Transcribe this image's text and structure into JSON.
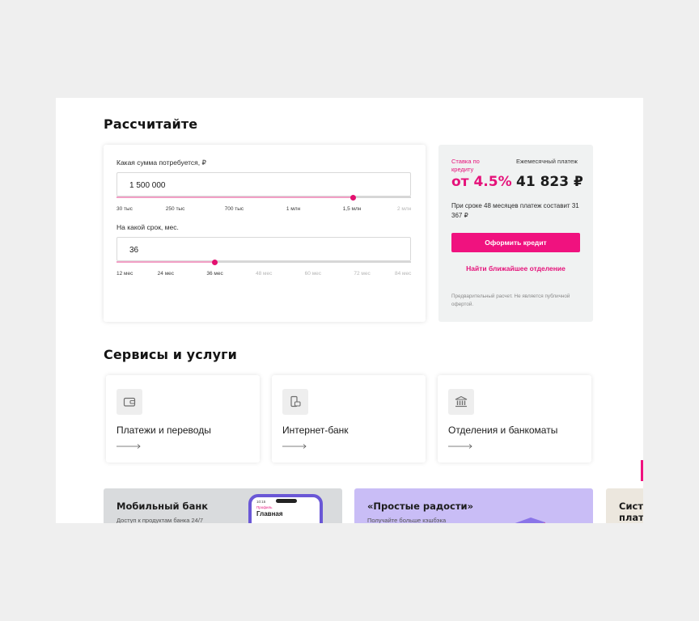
{
  "calculator": {
    "heading": "Рассчитайте",
    "amount": {
      "label": "Какая сумма потребуется, ₽",
      "value": "1 500 000",
      "slider_fraction": 0.803,
      "ticks": [
        {
          "label": "30 тыс",
          "active": true
        },
        {
          "label": "250 тыс",
          "active": true
        },
        {
          "label": "700 тыс",
          "active": true
        },
        {
          "label": "1 млн",
          "active": true
        },
        {
          "label": "1,5 млн",
          "active": true
        },
        {
          "label": "2 млн",
          "active": false
        }
      ]
    },
    "term": {
      "label": "На какой срок, мес.",
      "value": "36",
      "slider_fraction": 0.333,
      "ticks": [
        {
          "label": "12 мес",
          "active": true
        },
        {
          "label": "24 мес",
          "active": true
        },
        {
          "label": "36 мес",
          "active": true
        },
        {
          "label": "48 мес",
          "active": false
        },
        {
          "label": "60 мес",
          "active": false
        },
        {
          "label": "72 мес",
          "active": false
        },
        {
          "label": "84 мес",
          "active": false
        }
      ]
    }
  },
  "offer": {
    "rate_label": "Ставка по кредиту",
    "rate_value": "от 4.5%",
    "payment_label": "Ежемесячный платеж",
    "payment_value": "41 823 ₽",
    "summary": "При сроке 48 месяцев платеж составит 31 367 ₽",
    "apply_button": "Оформить кредит",
    "branch_link": "Найти ближайшее отделение",
    "disclaimer": "Предварительный расчет. Не является публичной офертой."
  },
  "services": {
    "heading": "Сервисы и услуги",
    "items": [
      {
        "title": "Платежи и переводы",
        "icon": "wallet-icon"
      },
      {
        "title": "Интернет-банк",
        "icon": "mobile-card-icon"
      },
      {
        "title": "Отделения и банкоматы",
        "icon": "bank-building-icon"
      }
    ]
  },
  "promos": [
    {
      "title": "Мобильный банк",
      "subtitle": "Доступ к продуктам банка 24/7",
      "phone_time": "10:15",
      "phone_profile": "Профиль",
      "phone_screen": "Главная"
    },
    {
      "title": "«Простые радости»",
      "subtitle": "Получайте больше кэшбэка"
    },
    {
      "title_line1": "Систе",
      "title_line2": "плат"
    }
  ],
  "colors": {
    "accent": "#e5127a",
    "button": "#f0127f",
    "slider_fill": "#f2a0c6",
    "offer_bg": "#f0f2f2",
    "promo_mobile_bg": "#d9dbdd",
    "promo_joy_bg": "#c9bdf6",
    "promo_third_bg": "#ece7de",
    "phone_frame": "#6a57d6"
  }
}
